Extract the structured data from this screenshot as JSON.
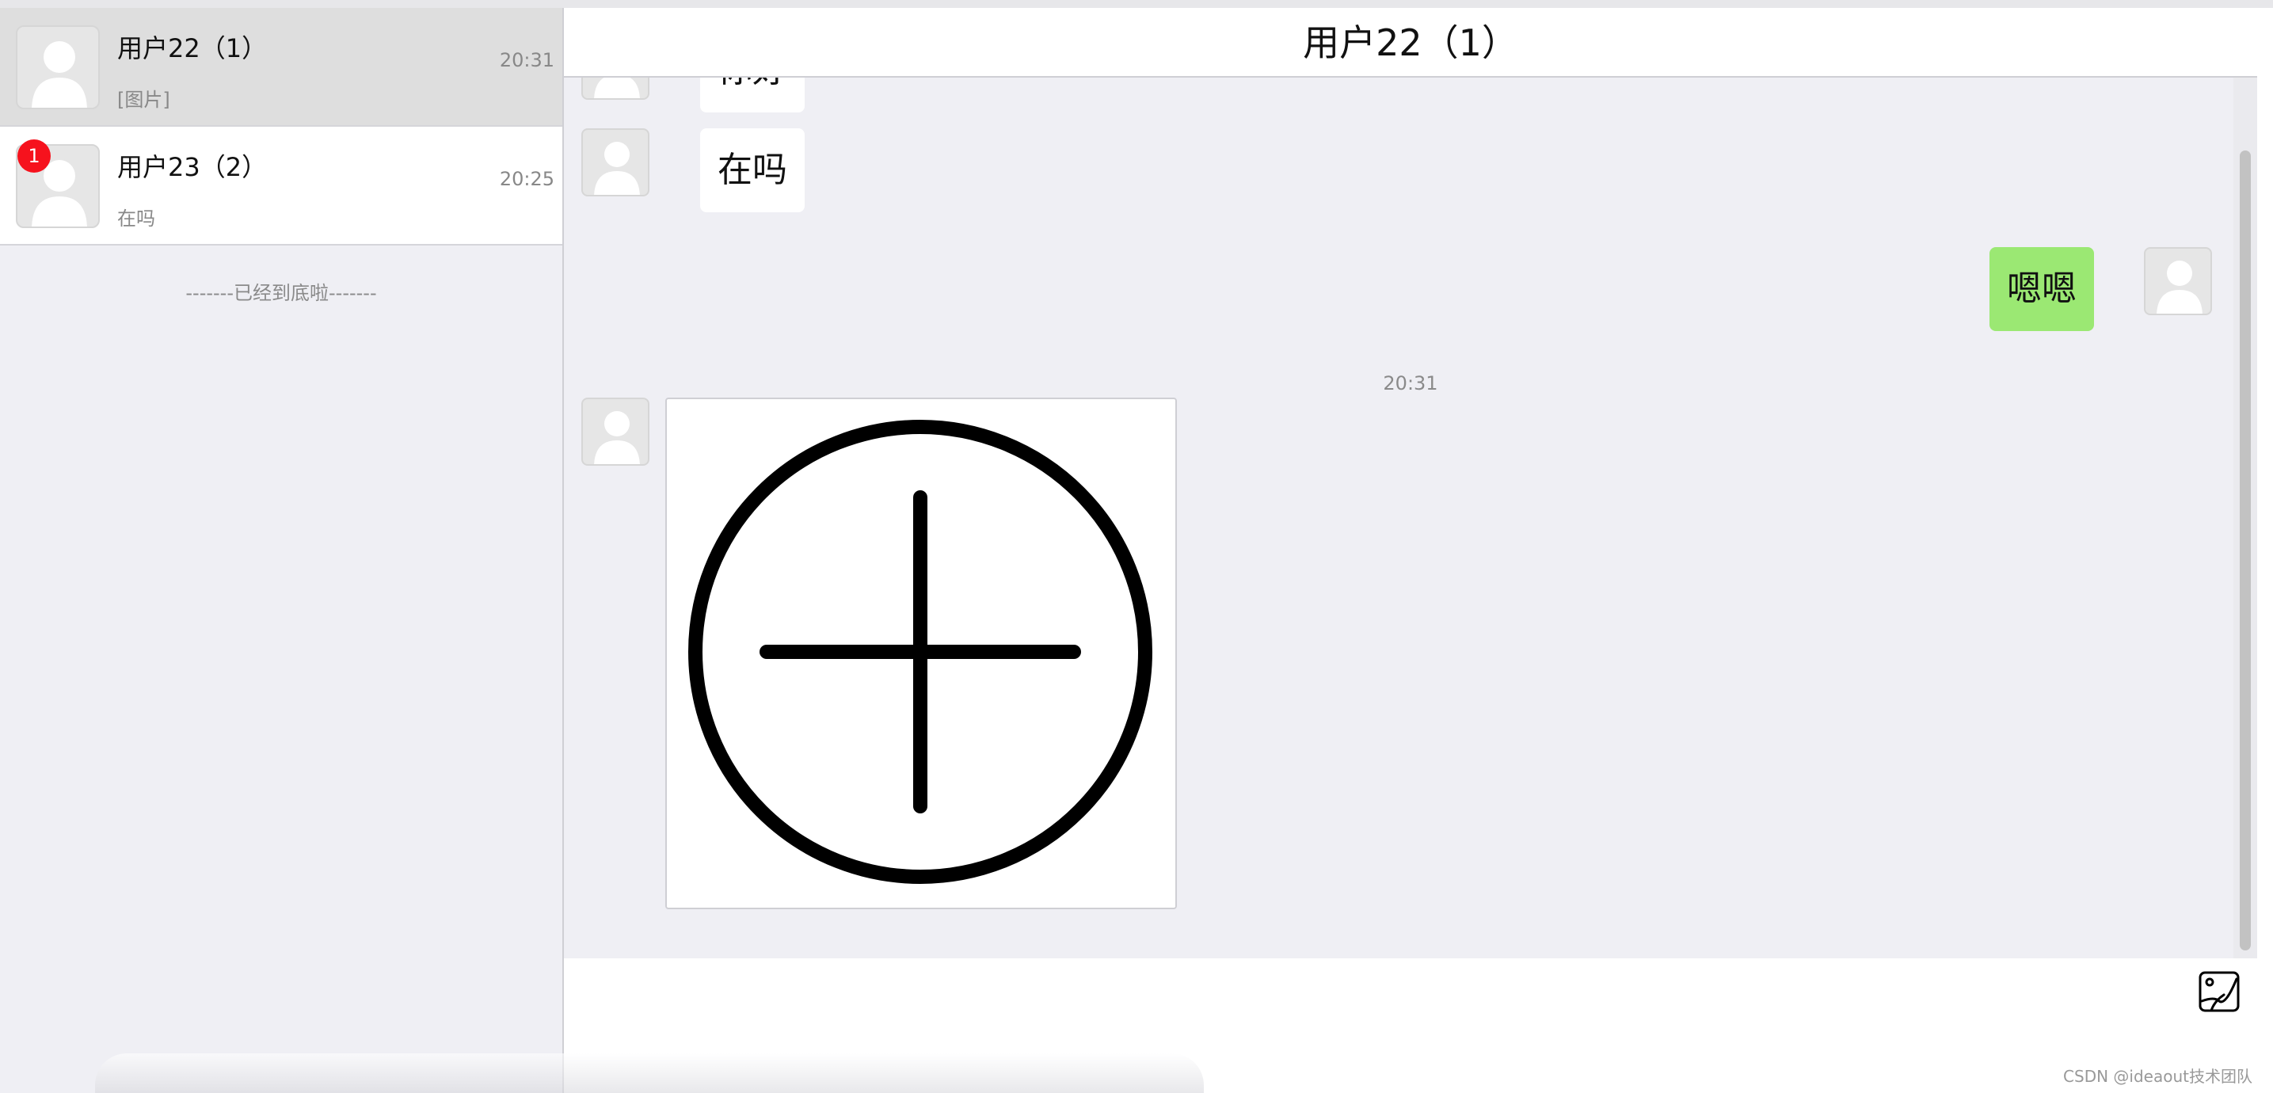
{
  "conversations": [
    {
      "name": "用户22（1）",
      "preview": "[图片]",
      "time": "20:31",
      "active": true
    },
    {
      "name": "用户23（2）",
      "preview": "在吗",
      "time": "20:25",
      "badge": "1"
    }
  ],
  "sidebar": {
    "bottom_note": "-------已经到底啦-------"
  },
  "chat": {
    "title": "用户22（1）",
    "messages": [
      {
        "side": "left",
        "text": "你好",
        "partial": true
      },
      {
        "side": "left",
        "text": "在吗"
      },
      {
        "side": "right",
        "text": "嗯嗯"
      },
      {
        "timestamp": "20:31"
      },
      {
        "side": "left",
        "type": "image",
        "image_icon": "plus-circle-icon"
      }
    ]
  },
  "input": {
    "image_button_icon": "image-upload-icon"
  },
  "watermark": "CSDN @ideaout技术团队",
  "colors": {
    "bubble_right": "#9be873",
    "badge": "#f6121d",
    "chat_bg": "#efeff4"
  }
}
